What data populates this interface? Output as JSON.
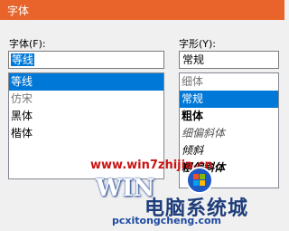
{
  "dialog": {
    "title": "字体"
  },
  "font": {
    "label": "字体(F):",
    "value": "等线",
    "items": [
      "等线",
      "仿宋",
      "黑体",
      "楷体"
    ]
  },
  "style": {
    "label": "字形(Y):",
    "value": "常规",
    "items": [
      "细体",
      "常规",
      "粗体",
      "细偏斜体",
      "倾斜",
      "粗偏斜体"
    ]
  },
  "watermark": {
    "url": "www.win7zhijia.cn",
    "brand": "WIN",
    "cn": "电脑系统城",
    "site": "pcxitongcheng.com"
  },
  "colors": {
    "accent": "#e8642a",
    "selection": "#0078d7",
    "watermark_red": "#c81414"
  }
}
